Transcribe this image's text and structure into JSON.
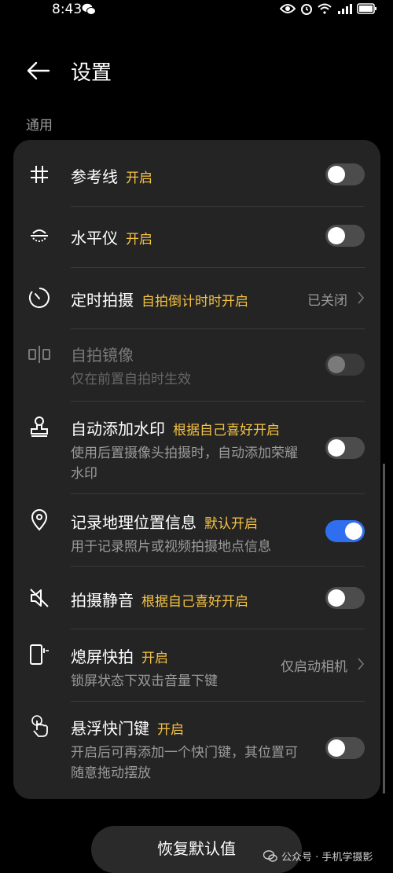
{
  "status": {
    "time": "8:43"
  },
  "header": {
    "title": "设置"
  },
  "section": {
    "label": "通用"
  },
  "rows": [
    {
      "title": "参考线",
      "note": "开启",
      "toggle": "off",
      "icon": "grid-icon"
    },
    {
      "title": "水平仪",
      "note": "开启",
      "toggle": "off",
      "icon": "level-icon"
    },
    {
      "title": "定时拍摄",
      "note": "自拍倒计时时开启",
      "value": "已关闭",
      "icon": "timer-icon"
    },
    {
      "title": "自拍镜像",
      "subtitle": "仅在前置自拍时生效",
      "toggle": "disabled",
      "icon": "mirror-icon"
    },
    {
      "title": "自动添加水印",
      "note": "根据自己喜好开启",
      "subtitle": "使用后置摄像头拍摄时，自动添加荣耀水印",
      "toggle": "off",
      "icon": "stamp-icon"
    },
    {
      "title": "记录地理位置信息",
      "note": "默认开启",
      "subtitle": "用于记录照片或视频拍摄地点信息",
      "toggle": "on",
      "icon": "location-icon"
    },
    {
      "title": "拍摄静音",
      "note": "根据自己喜好开启",
      "toggle": "off",
      "icon": "mute-icon"
    },
    {
      "title": "熄屏快拍",
      "note": "开启",
      "subtitle": "锁屏状态下双击音量下键",
      "value": "仅启动相机",
      "icon": "phone-volume-icon"
    },
    {
      "title": "悬浮快门键",
      "note": "开启",
      "subtitle": "开启后可再添加一个快门键，其位置可随意拖动摆放",
      "toggle": "off",
      "icon": "tap-icon"
    }
  ],
  "footer": {
    "reset_label": "恢复默认值"
  },
  "watermark": {
    "text": "公众号 · 手机学摄影"
  },
  "colors": {
    "accent": "#2f6fef",
    "note": "#f5c242",
    "card": "#242424"
  }
}
